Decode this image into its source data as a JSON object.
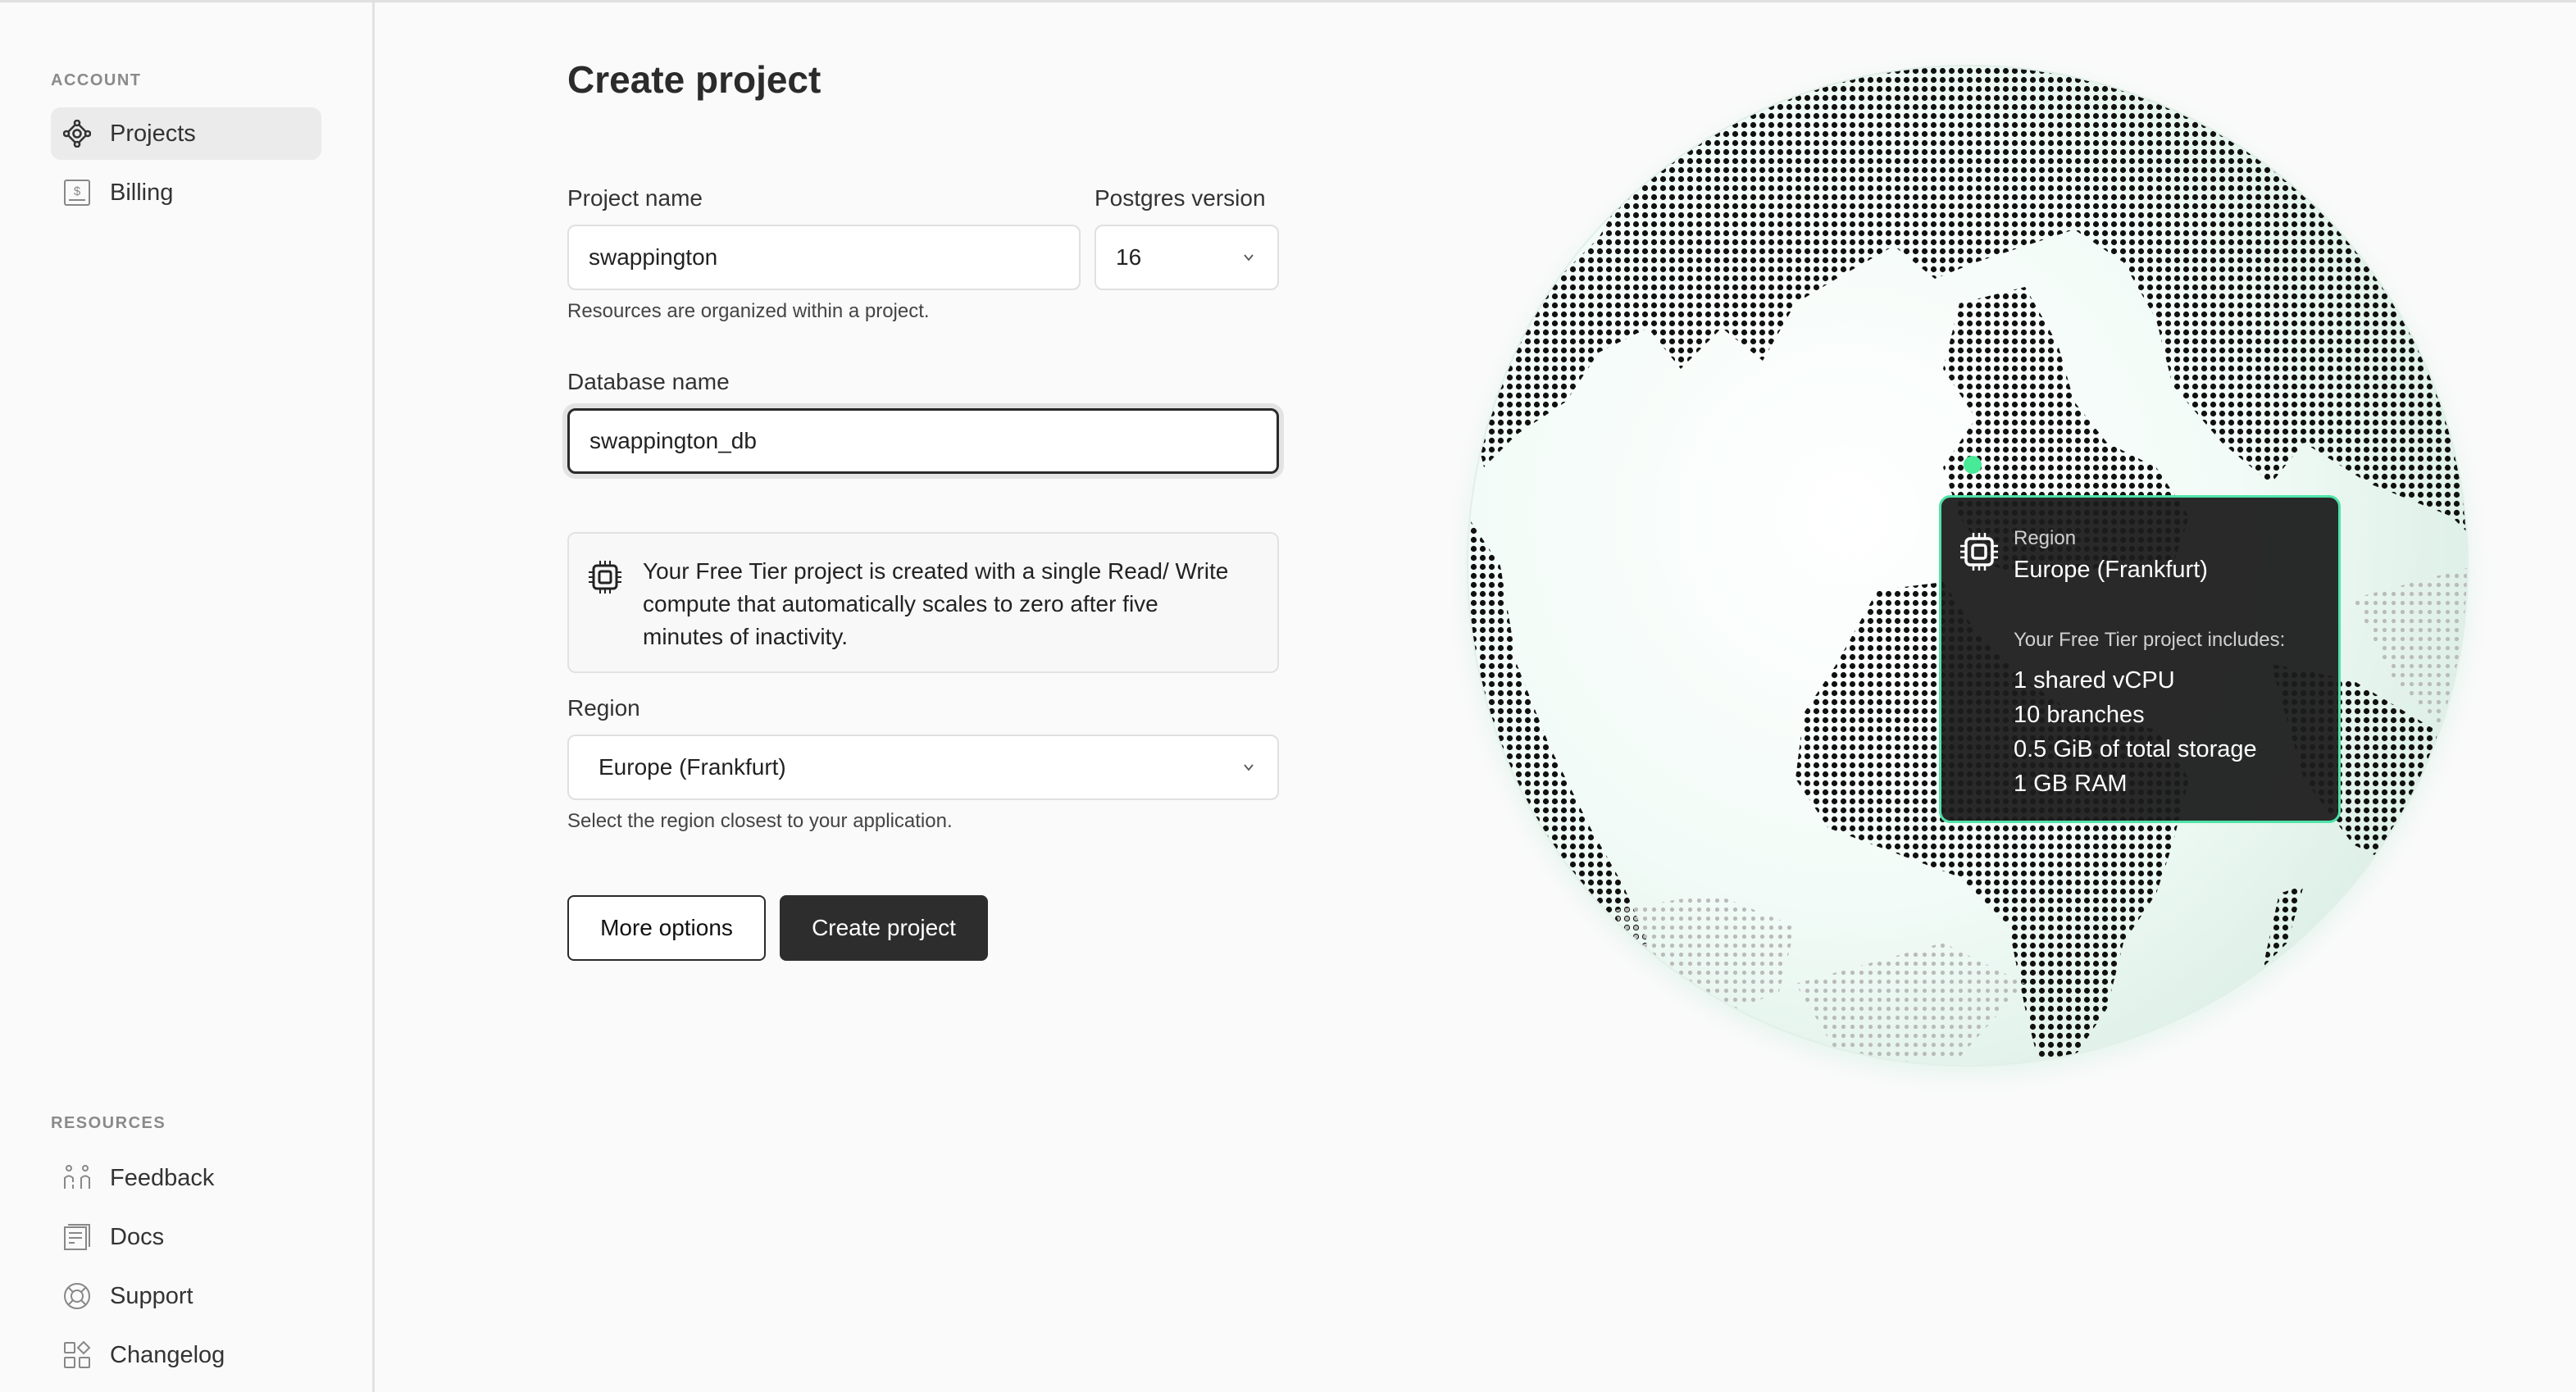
{
  "sidebar": {
    "account_label": "ACCOUNT",
    "account_items": [
      {
        "label": "Projects",
        "icon": "projects-icon",
        "active": true
      },
      {
        "label": "Billing",
        "icon": "billing-icon",
        "active": false
      }
    ],
    "resources_label": "RESOURCES",
    "resource_items": [
      {
        "label": "Feedback",
        "icon": "feedback-icon"
      },
      {
        "label": "Docs",
        "icon": "docs-icon"
      },
      {
        "label": "Support",
        "icon": "support-icon"
      },
      {
        "label": "Changelog",
        "icon": "changelog-icon"
      }
    ]
  },
  "form": {
    "title": "Create project",
    "project_name_label": "Project name",
    "project_name_value": "swappington",
    "project_name_hint": "Resources are organized within a project.",
    "postgres_version_label": "Postgres version",
    "postgres_version_value": "16",
    "database_name_label": "Database name",
    "database_name_value": "swappington_db",
    "notice_text": "Your Free Tier project is created with a single Read/ Write compute that automatically scales to zero after five minutes of inactivity.",
    "region_label": "Region",
    "region_value": "Europe (Frankfurt)",
    "region_hint": "Select the region closest to your application.",
    "more_options_label": "More options",
    "create_label": "Create project"
  },
  "tooltip": {
    "label": "Region",
    "region": "Europe (Frankfurt)",
    "includes_label": "Your Free Tier project includes:",
    "items": [
      "1 shared vCPU",
      "10 branches",
      "0.5 GiB of total storage",
      "1 GB RAM"
    ]
  },
  "colors": {
    "accent": "#47EA97",
    "tooltip_border": "#4FE3A8",
    "primary_button": "#2D2D2D"
  }
}
